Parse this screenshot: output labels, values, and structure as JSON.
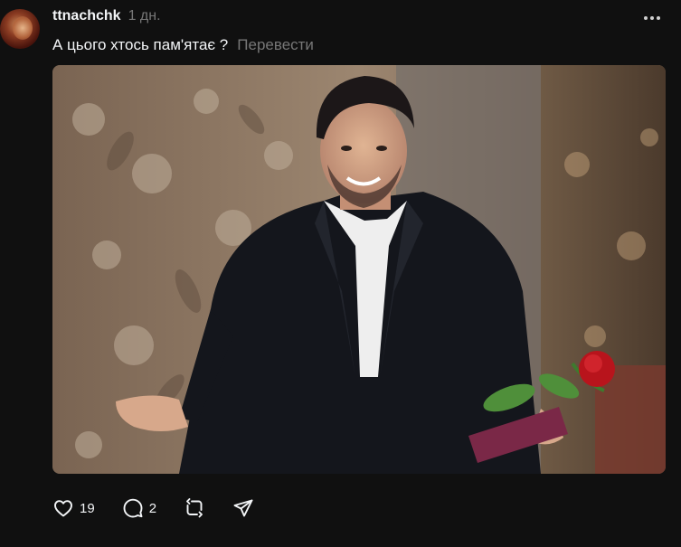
{
  "post": {
    "username": "ttnachchk",
    "timestamp": "1 дн.",
    "caption": "А цього хтось пам'ятає ?",
    "translate_label": "Перевести"
  },
  "actions": {
    "likes": "19",
    "comments": "2"
  },
  "icons": {
    "like": "heart-icon",
    "comment": "comment-icon",
    "repost": "repost-icon",
    "share": "share-icon",
    "more": "more-icon"
  }
}
